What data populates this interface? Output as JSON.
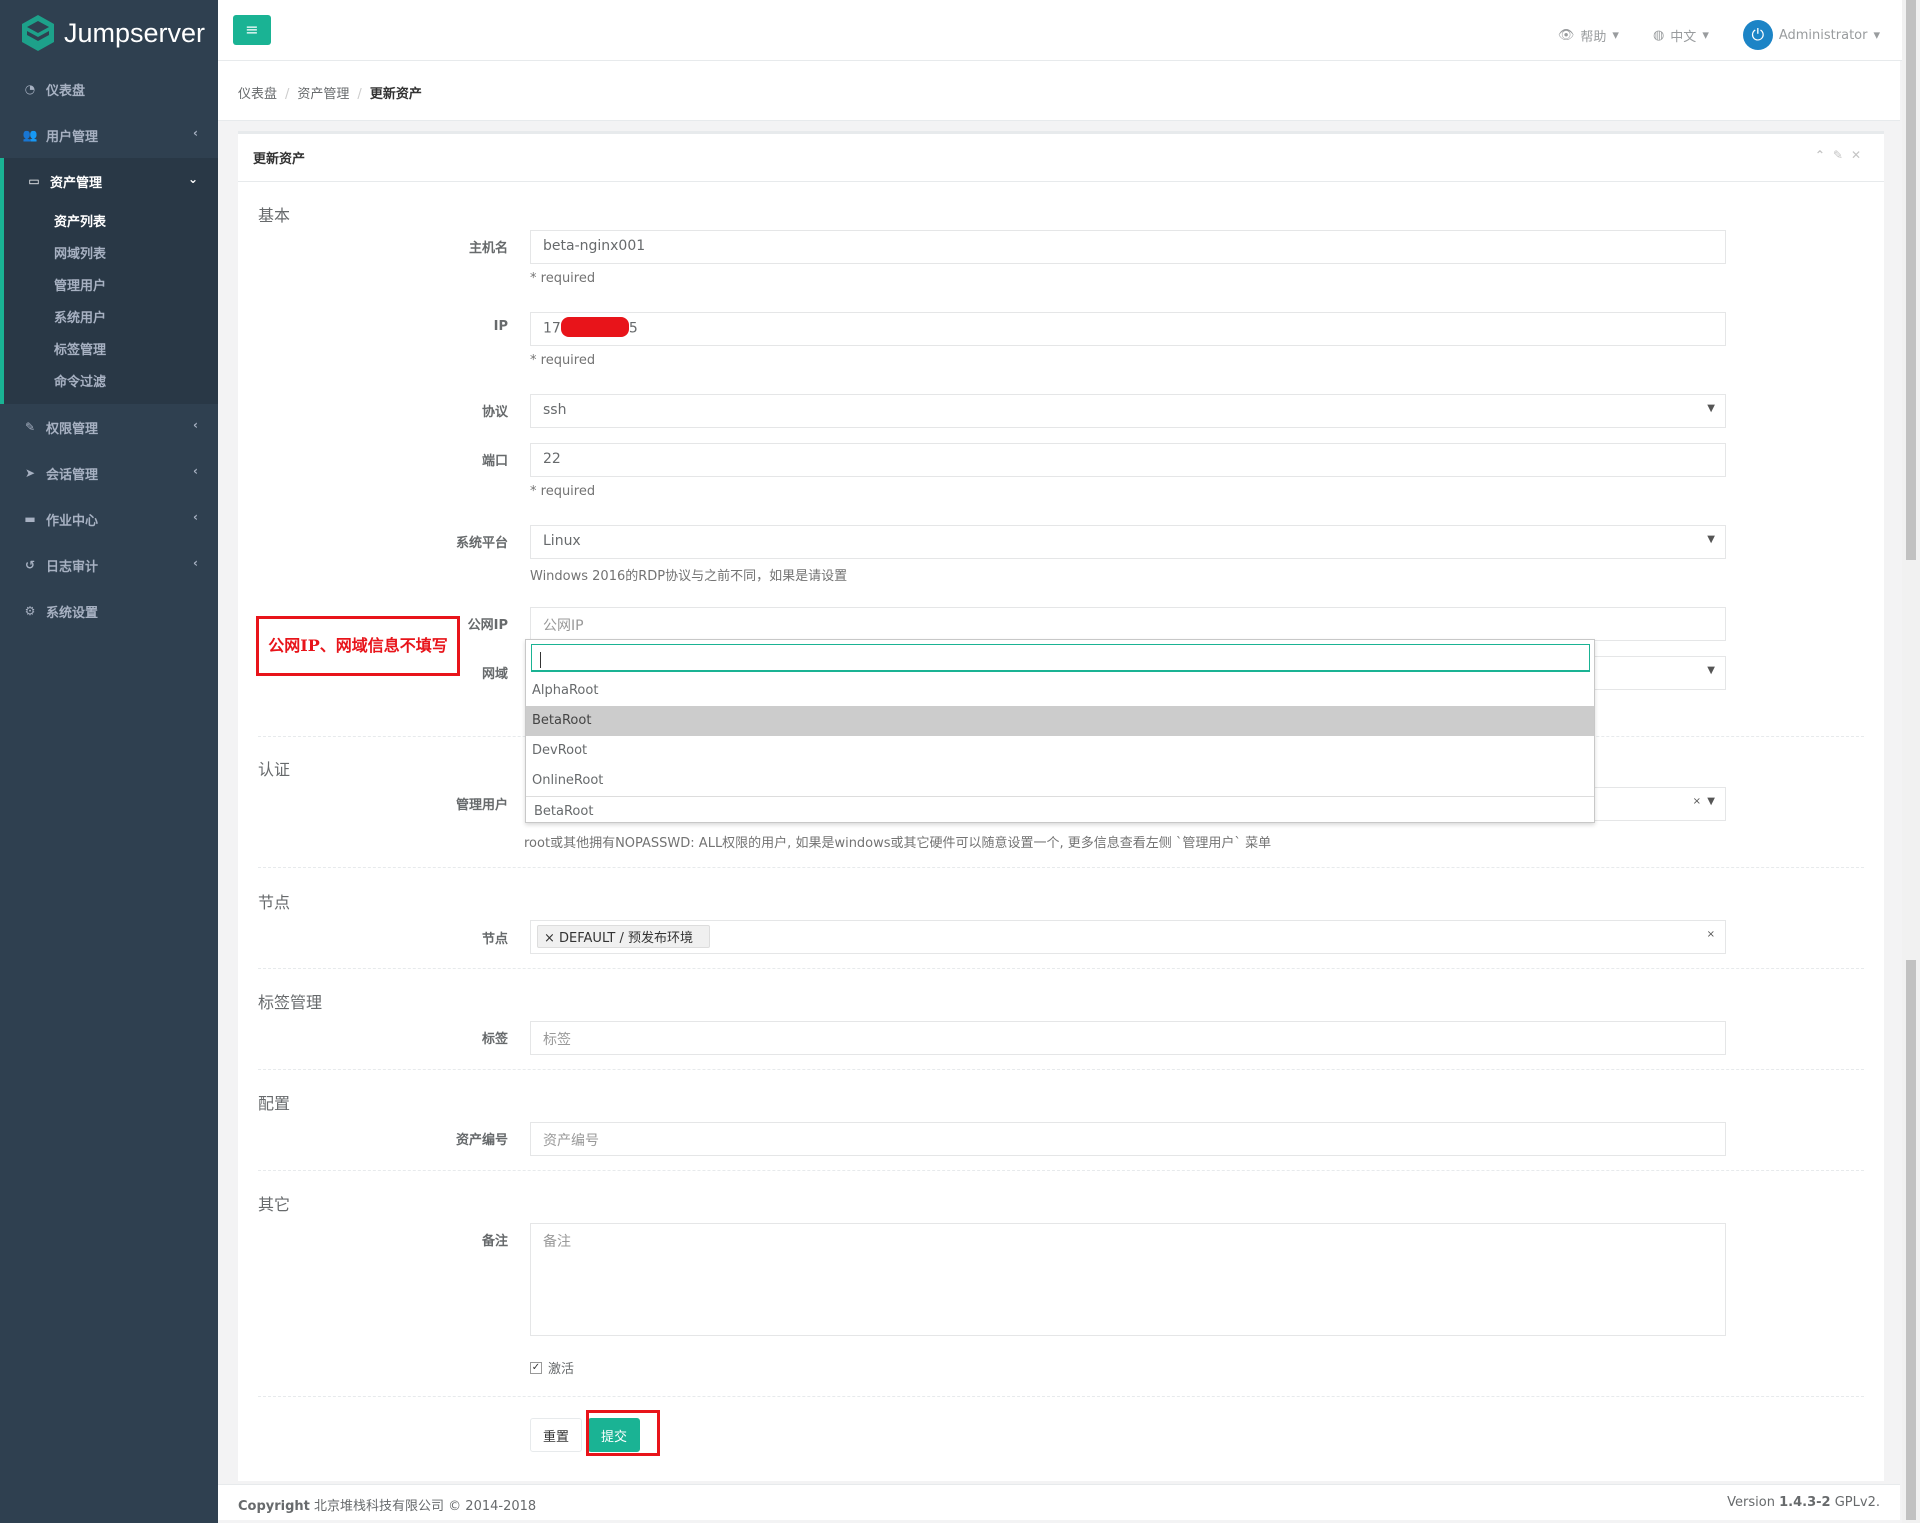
{
  "app": {
    "name": "Jumpserver"
  },
  "sidebar": {
    "items": [
      {
        "label": "仪表盘",
        "icon": "dashboard-icon"
      },
      {
        "label": "用户管理",
        "icon": "users-icon"
      },
      {
        "label": "资产管理",
        "icon": "inbox-icon",
        "active": true,
        "children": [
          "资产列表",
          "网域列表",
          "管理用户",
          "系统用户",
          "标签管理",
          "命令过滤"
        ]
      },
      {
        "label": "权限管理",
        "icon": "edit-icon"
      },
      {
        "label": "会话管理",
        "icon": "rocket-icon"
      },
      {
        "label": "作业中心",
        "icon": "desktop-icon"
      },
      {
        "label": "日志审计",
        "icon": "history-icon"
      },
      {
        "label": "系统设置",
        "icon": "gears-icon"
      }
    ]
  },
  "topbar": {
    "help": "帮助",
    "lang": "中文",
    "user": "Administrator"
  },
  "breadcrumb": [
    "仪表盘",
    "资产管理",
    "更新资产"
  ],
  "panel": {
    "title": "更新资产"
  },
  "form": {
    "sections": {
      "basic": "基本",
      "auth": "认证",
      "nodes": "节点",
      "labels": "标签管理",
      "config": "配置",
      "other": "其它"
    },
    "hostname": {
      "label": "主机名",
      "value": "beta-nginx001",
      "help": "* required"
    },
    "ip": {
      "label": "IP",
      "value_prefix": "17",
      "value_suffix": "5",
      "help": "* required"
    },
    "protocol": {
      "label": "协议",
      "value": "ssh"
    },
    "port": {
      "label": "端口",
      "value": "22",
      "help": "* required"
    },
    "platform": {
      "label": "系统平台",
      "value": "Linux",
      "help": "Windows 2016的RDP协议与之前不同，如果是请设置"
    },
    "public_ip": {
      "label": "公网IP",
      "placeholder": "公网IP"
    },
    "domain": {
      "label": "网域"
    },
    "admin_user": {
      "label": "管理用户",
      "help": "root或其他拥有NOPASSWD: ALL权限的用户, 如果是windows或其它硬件可以随意设置一个, 更多信息查看左侧 `管理用户` 菜单"
    },
    "nodes": {
      "label": "节点",
      "chip": "DEFAULT / 预发布环境"
    },
    "labels": {
      "label": "标签",
      "placeholder": "标签"
    },
    "number": {
      "label": "资产编号",
      "placeholder": "资产编号"
    },
    "comment": {
      "label": "备注",
      "placeholder": "备注"
    },
    "active": {
      "label": "激活",
      "checked": true
    },
    "reset": "重置",
    "submit": "提交"
  },
  "dropdown": {
    "options": [
      "AlphaRoot",
      "BetaRoot",
      "DevRoot",
      "OnlineRoot"
    ],
    "highlighted": "BetaRoot",
    "selected": "BetaRoot"
  },
  "annotation": {
    "text": "公网IP、网域信息不填写"
  },
  "footer": {
    "copyright_bold": "Copyright",
    "copyright": "北京堆栈科技有限公司 © 2014-2018",
    "version_prefix": "Version",
    "version": "1.4.3-2",
    "license": "GPLv2."
  },
  "colors": {
    "primary": "#1ab394",
    "sidebar": "#2f4050",
    "annotation": "#e8141a"
  }
}
